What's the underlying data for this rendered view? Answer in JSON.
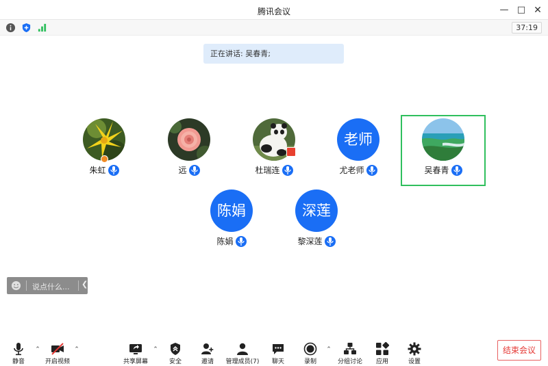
{
  "window": {
    "title": "腾讯会议"
  },
  "status": {
    "timer": "37:19"
  },
  "speaking": {
    "label": "正在讲话: 吴春青;"
  },
  "participants": [
    {
      "name": "朱虹",
      "avatar_text": ""
    },
    {
      "name": "远",
      "avatar_text": ""
    },
    {
      "name": "杜瑞连",
      "avatar_text": ""
    },
    {
      "name": "尤老师",
      "avatar_text": "老师"
    },
    {
      "name": "吴春青",
      "avatar_text": ""
    },
    {
      "name": "陈娟",
      "avatar_text": "陈娟"
    },
    {
      "name": "黎深莲",
      "avatar_text": "深莲"
    }
  ],
  "chat": {
    "placeholder": "说点什么..."
  },
  "toolbar": {
    "mute": "静音",
    "video": "开启视频",
    "share": "共享屏幕",
    "security": "安全",
    "invite": "邀请",
    "members": "管理成员(7)",
    "chat": "聊天",
    "record": "录制",
    "breakout": "分组讨论",
    "apps": "应用",
    "settings": "设置",
    "end": "结束会议"
  },
  "colors": {
    "accent_blue": "#1a6ef5",
    "active_border": "#2fbf5d",
    "end_red": "#e53935",
    "speaking_bg": "#dfecfb"
  }
}
